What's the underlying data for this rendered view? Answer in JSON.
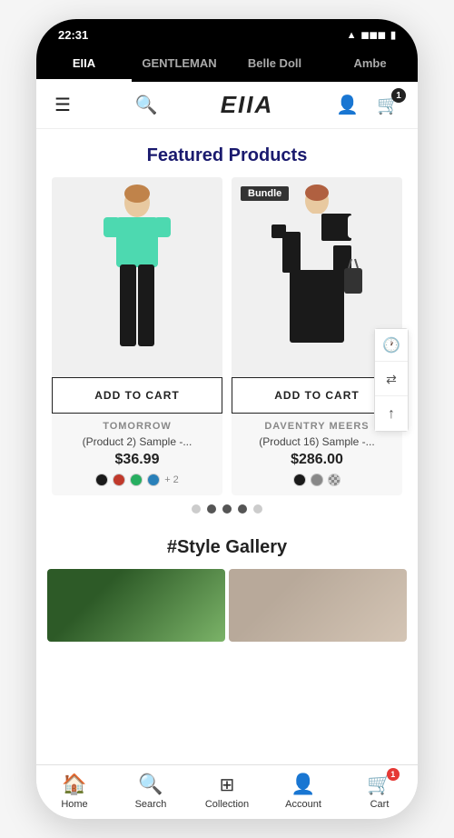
{
  "status": {
    "time": "22:31",
    "wifi": "📶",
    "battery": "🔋"
  },
  "brand_tabs": [
    {
      "label": "EIIA",
      "active": true
    },
    {
      "label": "GENTLEMAN",
      "active": false
    },
    {
      "label": "Belle Doll",
      "active": false
    },
    {
      "label": "Ambe",
      "active": false
    }
  ],
  "header": {
    "logo": "EIIA",
    "cart_count": "1"
  },
  "featured": {
    "title": "Featured Products"
  },
  "products": [
    {
      "id": 1,
      "bundle": false,
      "add_to_cart": "ADD TO CART",
      "brand": "TOMORROW",
      "name": "(Product 2) Sample -...",
      "price": "$36.99",
      "swatches": [
        "#1a1a1a",
        "#c0392b",
        "#27ae60",
        "#2980b9"
      ],
      "more": "+ 2"
    },
    {
      "id": 2,
      "bundle": true,
      "bundle_label": "Bundle",
      "add_to_cart": "ADD TO CART",
      "brand": "DAVENTRY MEERS",
      "name": "(Product 16) Sample -...",
      "price": "$286.00",
      "swatches": [
        "#1a1a1a",
        "#888",
        "#aaa"
      ],
      "more": null
    }
  ],
  "dots": [
    {
      "active": false
    },
    {
      "active": true
    },
    {
      "active": true
    },
    {
      "active": true
    },
    {
      "active": false
    }
  ],
  "gallery": {
    "title": "#Style Gallery"
  },
  "side_actions": [
    {
      "icon": "🕐",
      "name": "history-icon"
    },
    {
      "icon": "⇄",
      "name": "share-icon"
    },
    {
      "icon": "↑",
      "name": "scroll-top-icon"
    }
  ],
  "bottom_nav": [
    {
      "label": "Home",
      "icon": "🏠",
      "name": "home"
    },
    {
      "label": "Search",
      "icon": "🔍",
      "name": "search"
    },
    {
      "label": "Collection",
      "icon": "⊞",
      "name": "collection"
    },
    {
      "label": "Account",
      "icon": "👤",
      "name": "account"
    },
    {
      "label": "Cart",
      "icon": "🛒",
      "name": "cart",
      "badge": "1"
    }
  ]
}
